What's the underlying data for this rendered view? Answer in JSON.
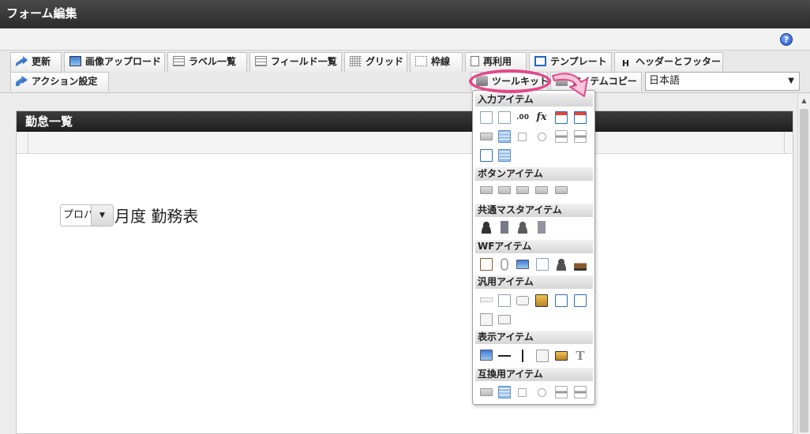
{
  "window": {
    "title": "フォーム編集"
  },
  "help": {
    "label": "?"
  },
  "toolbar": {
    "row1": [
      {
        "key": "update",
        "label": "更新"
      },
      {
        "key": "image-upload",
        "label": "画像アップロード"
      },
      {
        "key": "label-list",
        "label": "ラベル一覧"
      },
      {
        "key": "field-list",
        "label": "フィールド一覧"
      },
      {
        "key": "grid",
        "label": "グリッド"
      },
      {
        "key": "frame-line",
        "label": "枠線"
      },
      {
        "key": "reuse",
        "label": "再利用"
      },
      {
        "key": "template",
        "label": "テンプレート"
      },
      {
        "key": "header-footer",
        "label": "ヘッダーとフッター"
      }
    ],
    "row2": [
      {
        "key": "action-settings",
        "label": "アクション設定"
      },
      {
        "key": "toolkit",
        "label": "ツールキット"
      },
      {
        "key": "item-copy",
        "label": "アイテムコピー"
      }
    ],
    "language": {
      "value": "日本語"
    }
  },
  "form": {
    "header_title": "勤怠一覧",
    "select_value": "プロパ",
    "title_text": "月度 勤務表"
  },
  "toolkit_panel": {
    "sections": [
      {
        "title": "入力アイテム",
        "icons": [
          "text-field-icon",
          "text-area-icon",
          "number-field-icon",
          "formula-icon",
          "date-picker-icon",
          "datetime-picker-icon",
          "select-icon",
          "grid-table-icon",
          "checkbox-icon",
          "radio-icon",
          "list-box-icon",
          "table-icon",
          "file-upload-icon",
          "sheet-icon"
        ],
        "fx": "fx",
        "num": ".00"
      },
      {
        "title": "ボタンアイテム",
        "icons": [
          "submit-button-icon",
          "next-button-icon",
          "back-button-icon",
          "prev-button-icon",
          "forward-button-icon"
        ]
      },
      {
        "title": "共通マスタアイテム",
        "icons": [
          "user-icon",
          "company-icon",
          "org-user-icon",
          "dept-icon"
        ]
      },
      {
        "title": "WFアイテム",
        "icons": [
          "approval-icon",
          "attachment-icon",
          "image-icon",
          "history-icon",
          "process-icon",
          "stamp-icon"
        ]
      },
      {
        "title": "汎用アイテム",
        "icons": [
          "separator-icon",
          "document-icon",
          "camera-icon",
          "search-icon",
          "upload-icon",
          "download-icon",
          "panel-icon",
          "card-icon"
        ]
      },
      {
        "title": "表示アイテム",
        "icons": [
          "label-icon",
          "horizontal-line-icon",
          "vertical-line-icon",
          "box-icon",
          "picture-icon",
          "text-icon"
        ],
        "t": "T"
      },
      {
        "title": "互換用アイテム",
        "icons": [
          "select-icon",
          "grid-table-icon",
          "checkbox-icon",
          "radio-icon",
          "list-box-icon",
          "table-icon"
        ]
      }
    ]
  },
  "colors": {
    "highlight": "#e2488c",
    "titlebar": "#2b2b2b"
  }
}
